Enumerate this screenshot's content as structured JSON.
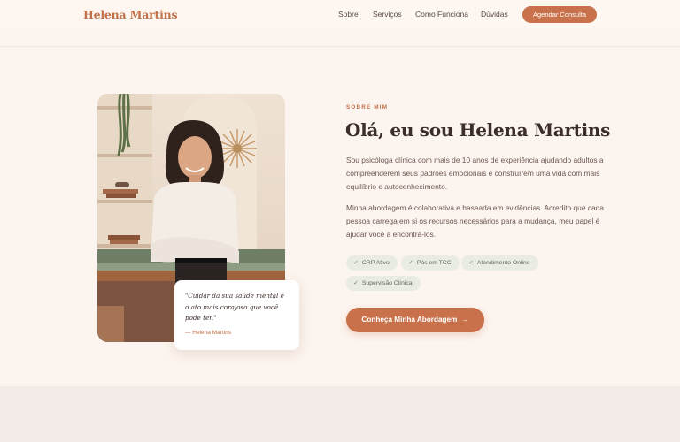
{
  "nav": {
    "brand": "Helena Martins",
    "links": [
      "Sobre",
      "Serviços",
      "Como Funciona",
      "Dúvidas"
    ],
    "cta": "Agendar Consulta"
  },
  "about": {
    "eyebrow": "SOBRE MIM",
    "title": "Olá, eu sou Helena Martins",
    "paragraph1": "Sou psicóloga clínica com mais de 10 anos de experiência ajudando adultos a compreenderem seus padrões emocionais e construírem uma vida com mais equilíbrio e autoconhecimento.",
    "paragraph2": "Minha abordagem é colaborativa e baseada em evidências. Acredito que cada pessoa carrega em si os recursos necessários para a mudança, meu papel é ajudar você a encontrá-los.",
    "badges": [
      "CRP Ativo",
      "Pós em TCC",
      "Atendimento Online",
      "Supervisão Clínica"
    ],
    "cta": "Conheça Minha Abordagem",
    "cta_icon": "arrow-right-icon"
  },
  "quote": {
    "text": "\"Cuidar da sua saúde mental é o ato mais corajoso que você pode ter.\"",
    "author": "— Helena Martins"
  },
  "colors": {
    "accent": "#c8714a",
    "background": "#fcf4ee",
    "heading": "#3c2e28",
    "badge_bg": "#e9ece2"
  }
}
